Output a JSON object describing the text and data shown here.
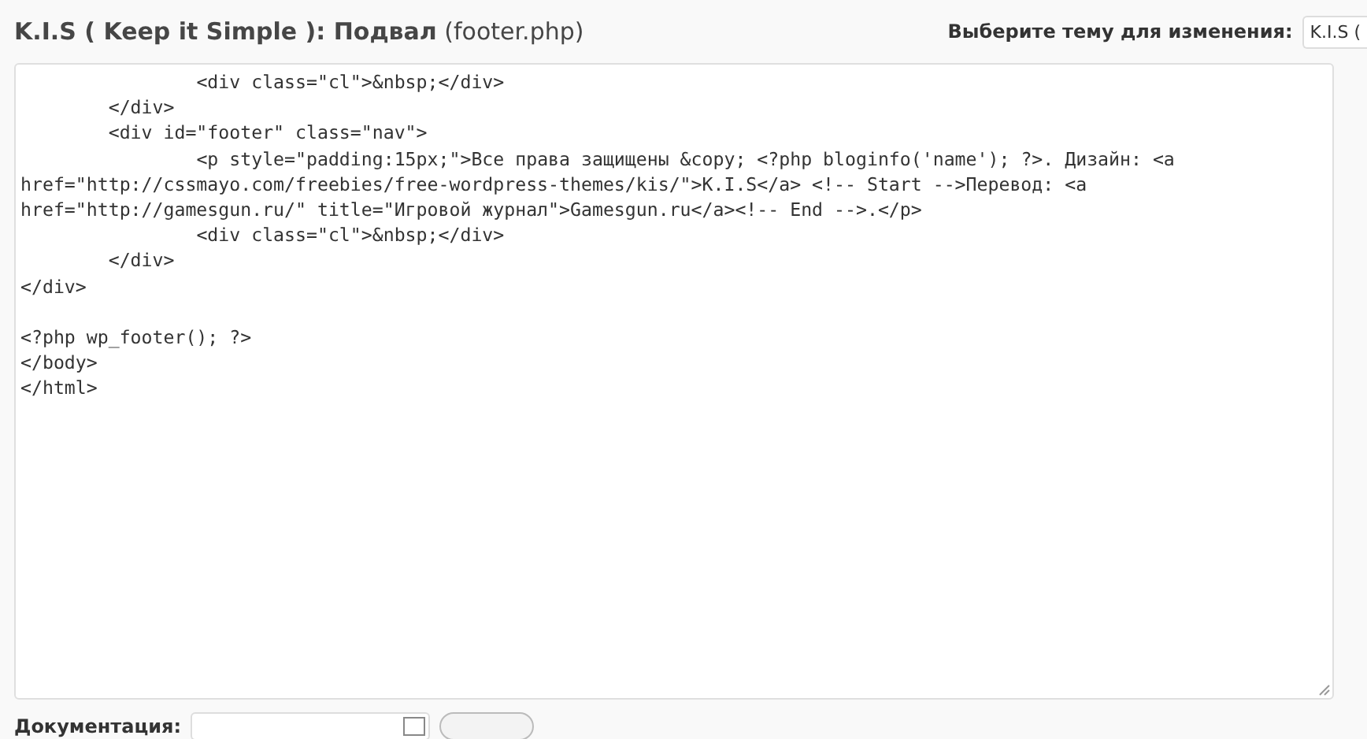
{
  "header": {
    "title": "**K.I.S ( Keep it Simple ): Подвал** (footer.php)",
    "theme_label": "Выберите тему для изменения:",
    "theme_select": {
      "value": "K.I.S ("
    }
  },
  "editor": {
    "blocks": [
      [
        "\t\t<div class=\"cl\">&nbsp;</div>",
        "\t</div>",
        "\t<div id=\"footer\" class=\"nav\">",
        "\t\t<p style=\"padding:15px;\">Все права защищены &copy; <?php bloginfo('name'); ?>. Дизайн: <a href=\"http://cssmayo.com/freebies/free-wordpress-themes/kis/\">K.I.S</a> <!-- Start -->Перевод: <a href=\"http://gamesgun.ru/\" title=\"Игровой журнал\">Gamesgun.ru</a><!-- End -->.</p>",
        "\t\t<div class=\"cl\">&nbsp;</div>",
        "\t</div>",
        "</div>"
      ],
      [
        "<?php wp_footer(); ?>",
        "</body>",
        "</html>"
      ]
    ]
  },
  "footer": {
    "doc_label": "Документация:"
  }
}
